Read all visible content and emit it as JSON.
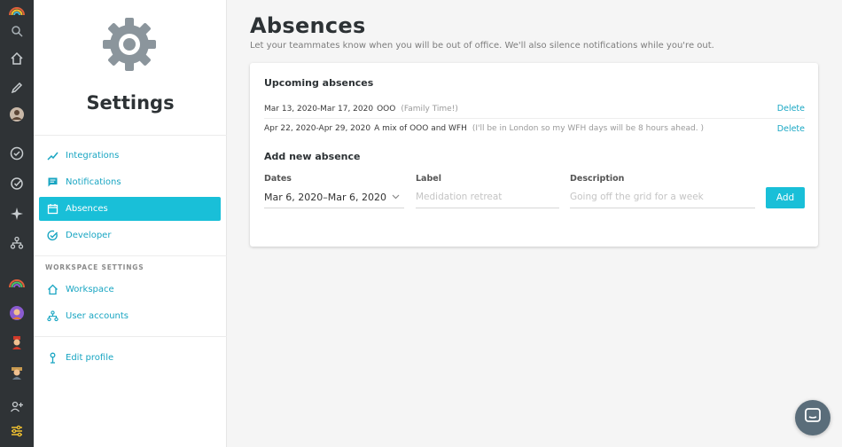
{
  "rail": {
    "icons": [
      "rainbow-logo-icon",
      "search-icon",
      "home-icon",
      "pencil-icon",
      "user-avatar-icon",
      "check-circle-icon",
      "target-check-icon",
      "sparkle-icon",
      "org-chart-icon",
      "rainbow-icon",
      "avatar-person-1-icon",
      "avatar-person-2-icon",
      "avatar-person-3-icon",
      "add-user-icon",
      "sliders-icon"
    ]
  },
  "sidebar": {
    "title": "Settings",
    "items": [
      {
        "label": "Integrations",
        "icon": "checkmark-trend-icon",
        "active": false
      },
      {
        "label": "Notifications",
        "icon": "chat-bubble-icon",
        "active": false
      },
      {
        "label": "Absences",
        "icon": "calendar-icon",
        "active": true
      },
      {
        "label": "Developer",
        "icon": "check-circle-icon",
        "active": false
      }
    ],
    "workspace_section_label": "WORKSPACE SETTINGS",
    "workspace_items": [
      {
        "label": "Workspace",
        "icon": "home-icon"
      },
      {
        "label": "User accounts",
        "icon": "org-chart-icon"
      }
    ],
    "profile_item": {
      "label": "Edit profile",
      "icon": "person-icon"
    }
  },
  "main": {
    "title": "Absences",
    "subtitle": "Let your teammates know when you will be out of office. We'll also silence notifications while you're out.",
    "upcoming_heading": "Upcoming absences",
    "absences": [
      {
        "dates": "Mar 13, 2020-Mar 17, 2020",
        "label": "OOO",
        "description": "(Family Time!)",
        "delete": "Delete"
      },
      {
        "dates": "Apr 22, 2020-Apr 29, 2020",
        "label": "A mix of OOO and WFH",
        "description": "(I'll be in London so my WFH days will be 8 hours ahead. )",
        "delete": "Delete"
      }
    ],
    "add_heading": "Add new absence",
    "form": {
      "dates_label": "Dates",
      "dates_value": "Mar 6, 2020–Mar 6, 2020",
      "label_label": "Label",
      "label_placeholder": "Medidation retreat",
      "description_label": "Description",
      "description_placeholder": "Going off the grid for a week",
      "add_button": "Add"
    }
  },
  "colors": {
    "accent": "#19bfd8",
    "link": "#18a5c2",
    "rail_bg": "#2f3336",
    "page_bg": "#f5f5f5"
  }
}
